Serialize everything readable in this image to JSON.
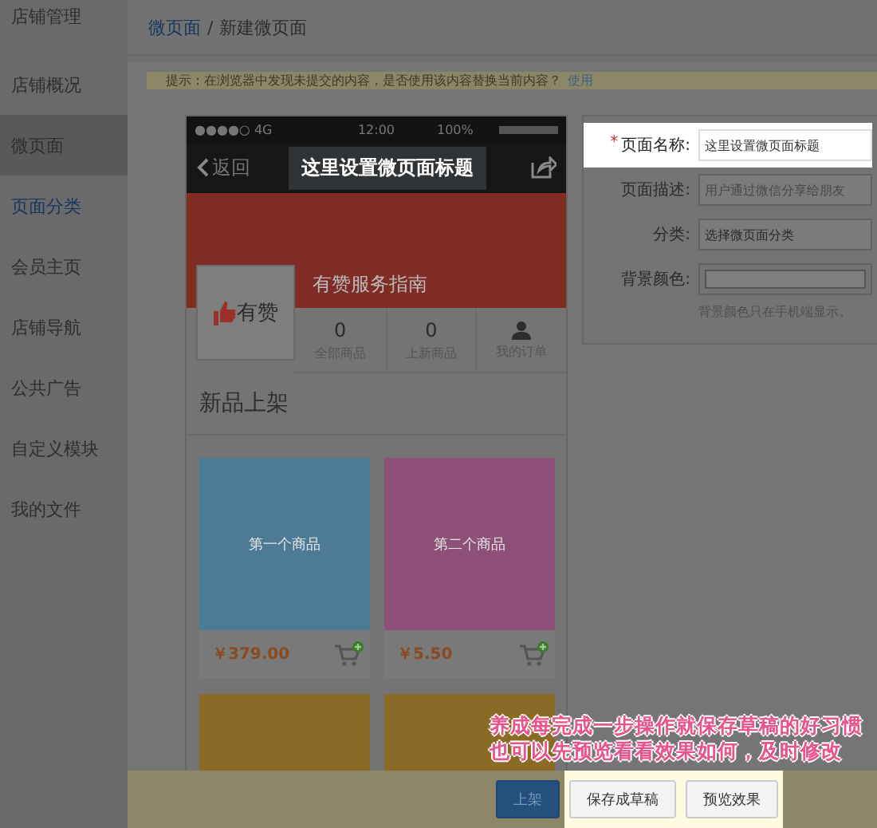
{
  "sidebar": {
    "title": "店铺管理",
    "items": [
      {
        "label": "店铺概况",
        "selected": false,
        "kind": "normal"
      },
      {
        "label": "微页面",
        "selected": true,
        "kind": "normal"
      },
      {
        "label": "页面分类",
        "selected": false,
        "kind": "link"
      },
      {
        "label": "会员主页",
        "selected": false,
        "kind": "normal"
      },
      {
        "label": "店铺导航",
        "selected": false,
        "kind": "normal"
      },
      {
        "label": "公共广告",
        "selected": false,
        "kind": "normal"
      },
      {
        "label": "自定义模块",
        "selected": false,
        "kind": "normal"
      },
      {
        "label": "我的文件",
        "selected": false,
        "kind": "normal"
      }
    ]
  },
  "breadcrumb": {
    "separator": "/",
    "items": [
      {
        "label": "微页面",
        "kind": "link"
      },
      {
        "label": "新建微页面",
        "kind": "current"
      }
    ]
  },
  "notice": {
    "text": "提示：在浏览器中发现未提交的内容，是否使用该内容替换当前内容？",
    "action": "使用"
  },
  "phone": {
    "status_bar": {
      "signal": "●●●●○",
      "network": "4G",
      "time": "12:00",
      "battery": "100%"
    },
    "back": "返回",
    "title": "这里设置微页面标题",
    "title_highlighted": true,
    "shop": {
      "logo_text": "有赞",
      "name": "有赞服务指南",
      "stats": [
        {
          "kind": "count",
          "value": "0",
          "label": "全部商品"
        },
        {
          "kind": "count",
          "value": "0",
          "label": "上新商品"
        },
        {
          "kind": "icon",
          "label": "我的订单"
        }
      ]
    },
    "section_title": "新品上架",
    "products": [
      {
        "name": "第一个商品",
        "price": "￥379.00",
        "color": "#4d7b96"
      },
      {
        "name": "第二个商品",
        "price": "￥5.50",
        "color": "#8e4f78"
      },
      {
        "color": "#8a6a24"
      },
      {
        "color": "#8a6a24"
      }
    ]
  },
  "form": {
    "fields": [
      {
        "kind": "text",
        "label": "页面名称:",
        "required_mark": "*",
        "value": "这里设置微页面标题",
        "highlighted": true
      },
      {
        "kind": "text",
        "label": "页面描述:",
        "placeholder": "用户通过微信分享给朋友",
        "highlighted": false
      },
      {
        "kind": "select",
        "label": "分类:",
        "value": "选择微页面分类",
        "highlighted": false
      },
      {
        "kind": "color",
        "label": "背景颜色:",
        "hint": "背景颜色只在手机端显示。",
        "highlighted": false
      }
    ]
  },
  "footer": {
    "buttons": [
      {
        "kind": "primary",
        "label": "上架",
        "highlighted": false
      },
      {
        "kind": "default",
        "label": "保存成草稿",
        "highlighted": true
      },
      {
        "kind": "default",
        "label": "预览效果",
        "highlighted": true
      }
    ]
  },
  "annotation": {
    "lines": [
      "养成每完成一步操作就保存草稿的好习惯",
      "也可以先预览看看效果如何，及时修改"
    ]
  }
}
